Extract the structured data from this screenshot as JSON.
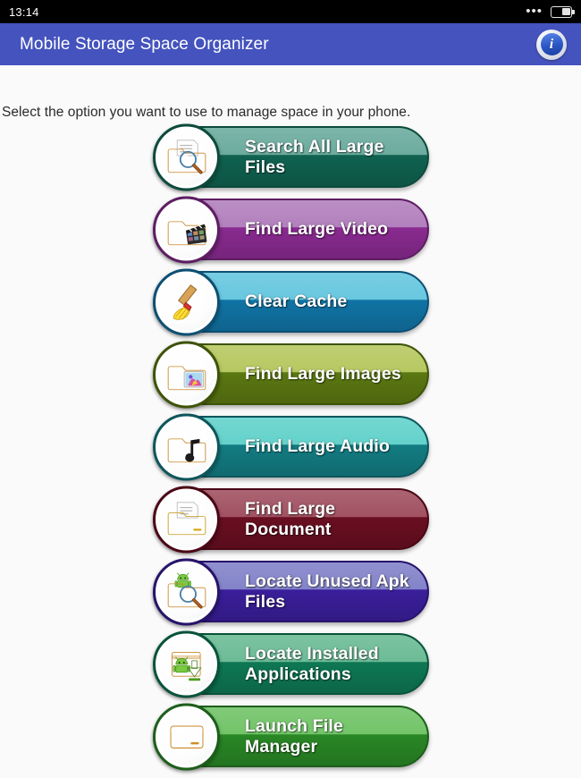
{
  "status_bar": {
    "time": "13:14",
    "overflow_icon": "more-dots-icon",
    "overflow_glyph": "•••",
    "battery_icon": "battery-icon"
  },
  "app_bar": {
    "title": "Mobile Storage Space Organizer",
    "background_color": "#4453bd",
    "info_icon": "info-icon",
    "info_glyph": "i"
  },
  "main": {
    "instruction": "Select the option you want to use to manage space in your phone.",
    "background_color": "#fafafa",
    "options": [
      {
        "label": "Search All Large Files",
        "icon": "folder-search-icon",
        "color_top": "#4f9b8b",
        "color_bottom": "#106452",
        "border_color": "#0c4a3c"
      },
      {
        "label": "Find Large Video",
        "icon": "folder-video-icon",
        "color_top": "#a367b0",
        "color_bottom": "#8c2b93",
        "border_color": "#5d1d63"
      },
      {
        "label": "Clear Cache",
        "icon": "broom-icon",
        "color_top": "#49bcd9",
        "color_bottom": "#1176a8",
        "border_color": "#0d4f73"
      },
      {
        "label": "Find Large Images",
        "icon": "folder-image-icon",
        "color_top": "#a8bd41",
        "color_bottom": "#5d7a12",
        "border_color": "#3e5308"
      },
      {
        "label": "Find Large Audio",
        "icon": "folder-audio-icon",
        "color_top": "#44c9c0",
        "color_bottom": "#137f85",
        "border_color": "#0c565c"
      },
      {
        "label": "Find Large Document",
        "icon": "folder-document-icon",
        "color_top": "#8e2f42",
        "color_bottom": "#6b0f22",
        "border_color": "#4b0716"
      },
      {
        "label": "Locate Unused Apk Files",
        "icon": "folder-apk-search-icon",
        "color_top": "#6a6abf",
        "color_bottom": "#3b1f9e",
        "border_color": "#27136b"
      },
      {
        "label": "Locate Installed Applications",
        "icon": "folder-app-download-icon",
        "color_top": "#4fae81",
        "color_bottom": "#0e7a55",
        "border_color": "#08533a"
      },
      {
        "label": "Launch File Manager",
        "icon": "folder-plain-icon",
        "color_top": "#56b84a",
        "color_bottom": "#2a8a26",
        "border_color": "#1d5e1a"
      }
    ]
  }
}
